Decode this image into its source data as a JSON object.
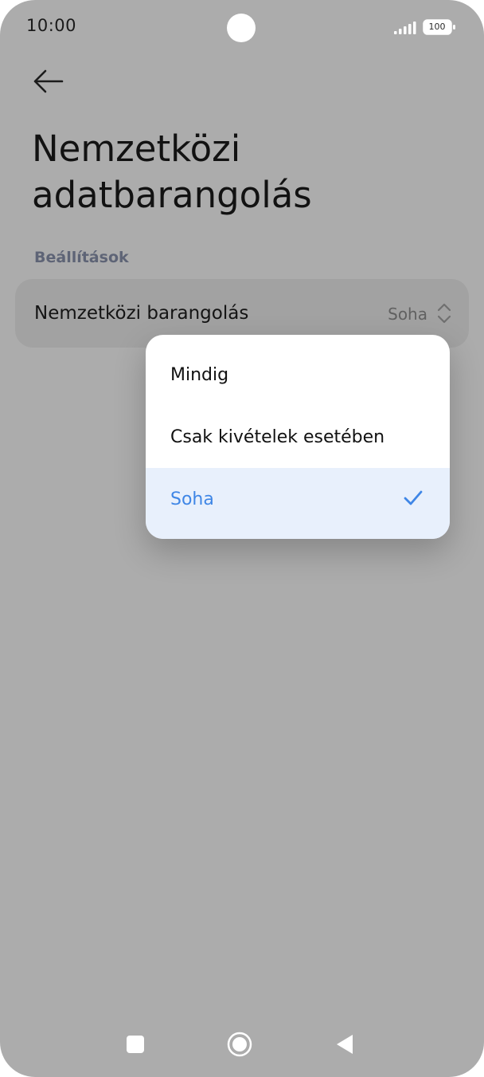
{
  "status_bar": {
    "time": "10:00",
    "battery_level": "100",
    "icons": [
      "camera-cutout",
      "signal-icon",
      "battery-icon"
    ]
  },
  "header": {
    "back_icon": "arrow-left-icon",
    "title_line1": "Nemzetközi",
    "title_line2": "adatbarangolás"
  },
  "settings": {
    "section_header": "Beállítások",
    "roaming": {
      "label": "Nemzetközi barangolás",
      "value": "Soha",
      "icon": "chevron-up-down-icon"
    }
  },
  "dropdown": {
    "options": [
      {
        "label": "Mindig",
        "selected": false
      },
      {
        "label": "Csak kivételek esetében",
        "selected": false
      },
      {
        "label": "Soha",
        "selected": true
      }
    ],
    "check_icon": "check-icon"
  },
  "navbar": {
    "icons": [
      "recents-square-icon",
      "home-circle-icon",
      "back-triangle-icon"
    ]
  },
  "colors": {
    "background_dim": "#acacac",
    "accent": "#3f86e6",
    "selected_bg": "#e8f0fc",
    "section_header": "#5e6476"
  }
}
